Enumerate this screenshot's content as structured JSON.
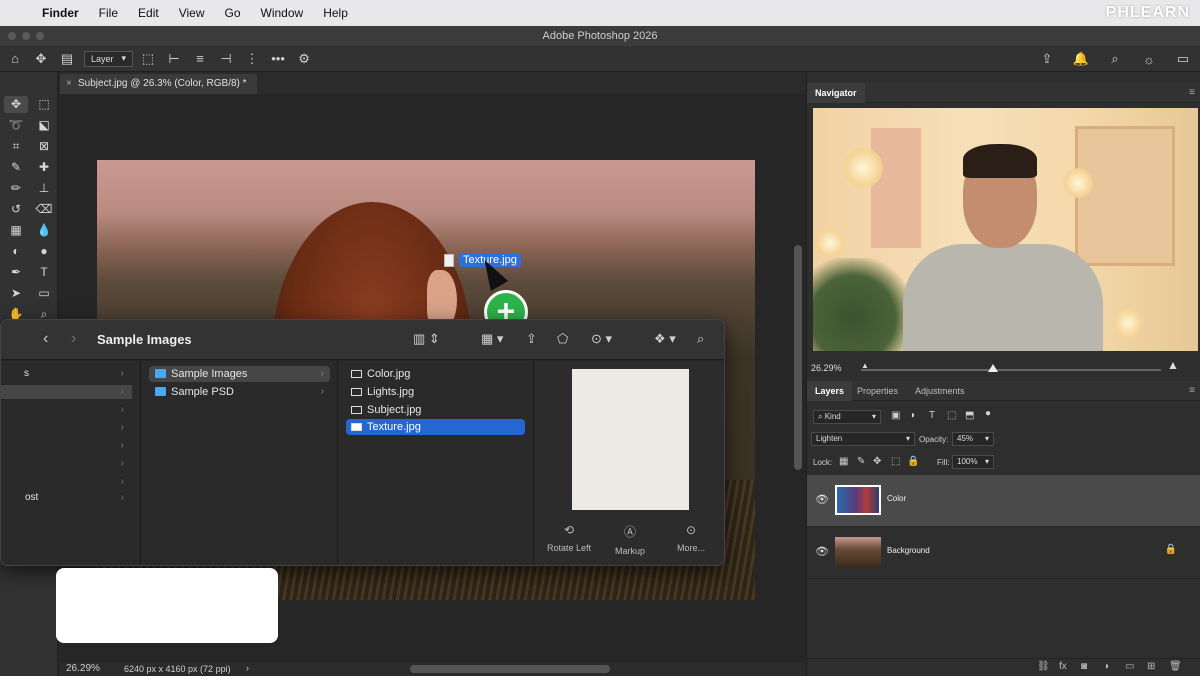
{
  "menubar": {
    "app": "Finder",
    "items": [
      "File",
      "Edit",
      "View",
      "Go",
      "Window",
      "Help"
    ],
    "brand": "PHLEARN"
  },
  "photoshop": {
    "window_title": "Adobe Photoshop 2026",
    "options_bar": {
      "layer_select": "Layer"
    },
    "doc_tab": "Subject.jpg @ 26.3% (Color, RGB/8) *",
    "status": {
      "zoom": "26.29%",
      "dimensions": "6240 px x 4160 px (72 ppi)"
    }
  },
  "drag": {
    "filename": "Texture.jpg",
    "plus": "+"
  },
  "finder": {
    "title": "Sample Images",
    "col1_stub_texts": [
      "s",
      "ost"
    ],
    "folders": [
      "Sample Images",
      "Sample PSD"
    ],
    "files": [
      "Color.jpg",
      "Lights.jpg",
      "Subject.jpg",
      "Texture.jpg"
    ],
    "selected_file": "Texture.jpg",
    "quick_actions": [
      "Rotate Left",
      "Markup",
      "More..."
    ]
  },
  "navigator": {
    "tab": "Navigator",
    "zoom": "26.29%",
    "zoom_level": 0.44
  },
  "layers_panel": {
    "tabs": [
      "Layers",
      "Properties",
      "Adjustments"
    ],
    "filter": "Kind",
    "blend_mode": "Lighten",
    "opacity_label": "Opacity:",
    "opacity": "45%",
    "lock_label": "Lock:",
    "fill_label": "Fill:",
    "fill": "100%",
    "layers": [
      {
        "name": "Color",
        "selected": true
      },
      {
        "name": "Background",
        "locked": true
      }
    ]
  }
}
